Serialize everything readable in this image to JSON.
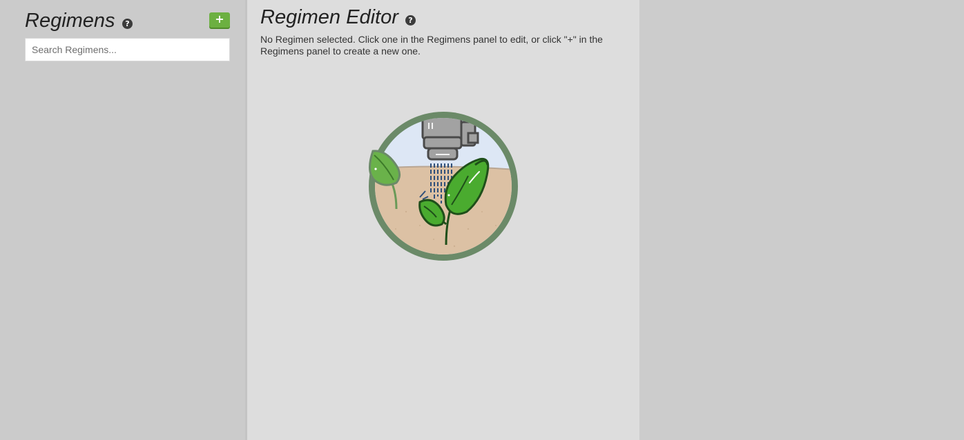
{
  "regimens_panel": {
    "title": "Regimens",
    "help_icon": "?",
    "add_button_label": "+",
    "search_placeholder": "Search Regimens..."
  },
  "editor_panel": {
    "title": "Regimen Editor",
    "help_icon": "?",
    "empty_message": "No Regimen selected. Click one in the Regimens panel to edit, or click \"+\" in the Regimens panel to create a new one."
  },
  "colors": {
    "add_button": "#6cb041",
    "left_panel_bg": "#cbcbcb",
    "middle_panel_bg": "#dddddd",
    "right_panel_bg": "#cccccc",
    "illustration_ring": "#6b8a68",
    "leaf": "#4aab2f"
  }
}
